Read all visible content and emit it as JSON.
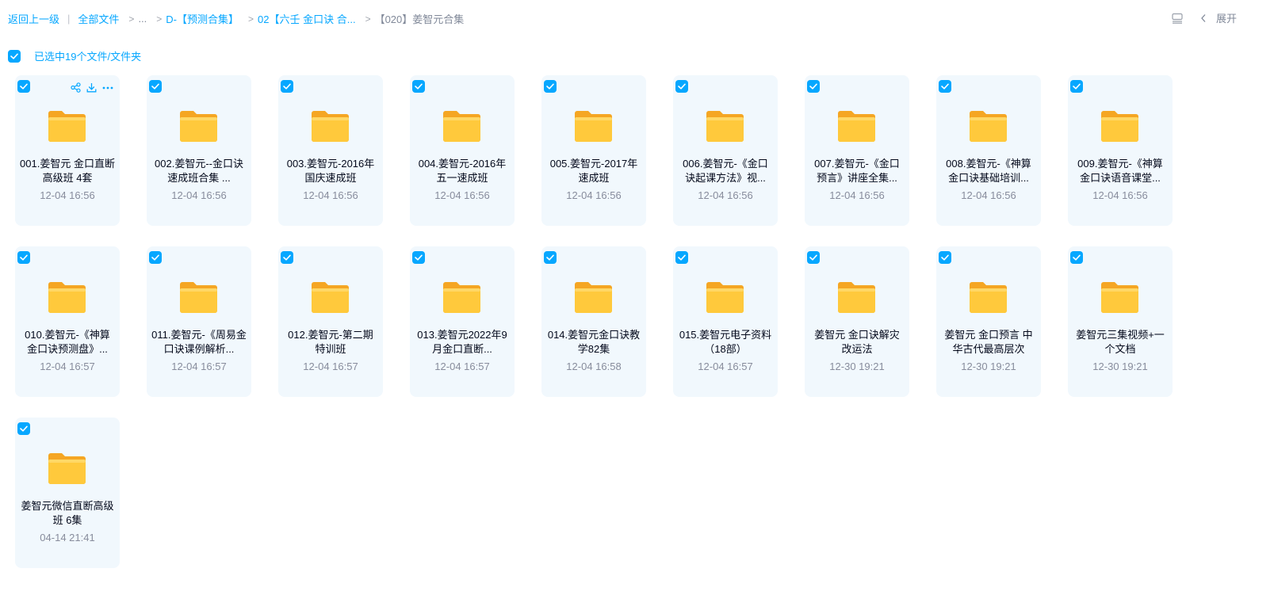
{
  "breadcrumb": {
    "back": "返回上一级",
    "all_files": "全部文件",
    "ellipsis": "...",
    "separator": ">",
    "level1": "D-【预测合集】",
    "level2": "02【六壬 金口诀 合...",
    "current": "【020】姜智元合集"
  },
  "toolbar": {
    "expand": "展开",
    "list_icon": "list-view-icon",
    "chevron_icon": "chevron-left-icon"
  },
  "selection": {
    "text": "已选中19个文件/文件夹"
  },
  "colors": {
    "accent": "#06a7ff",
    "card_bg": "#f1f8fd",
    "folder": "#ffc93c",
    "time": "#878c9c"
  },
  "items": [
    {
      "name": "001.姜智元 金口直断高级班 4套",
      "time": "12-04 16:56"
    },
    {
      "name": "002.姜智元--金口诀速成班合集 ...",
      "time": "12-04 16:56"
    },
    {
      "name": "003.姜智元-2016年国庆速成班",
      "time": "12-04 16:56"
    },
    {
      "name": "004.姜智元-2016年五一速成班",
      "time": "12-04 16:56"
    },
    {
      "name": "005.姜智元-2017年速成班",
      "time": "12-04 16:56"
    },
    {
      "name": "006.姜智元-《金口诀起课方法》视...",
      "time": "12-04 16:56"
    },
    {
      "name": "007.姜智元-《金口预言》讲座全集...",
      "time": "12-04 16:56"
    },
    {
      "name": "008.姜智元-《神算金口诀基础培训...",
      "time": "12-04 16:56"
    },
    {
      "name": "009.姜智元-《神算金口诀语音课堂...",
      "time": "12-04 16:56"
    },
    {
      "name": "010.姜智元-《神算金口诀预测盘》...",
      "time": "12-04 16:57"
    },
    {
      "name": "011.姜智元-《周易金口诀课例解析...",
      "time": "12-04 16:57"
    },
    {
      "name": "012.姜智元-第二期特训班",
      "time": "12-04 16:57"
    },
    {
      "name": "013.姜智元2022年9月金口直断...",
      "time": "12-04 16:57"
    },
    {
      "name": "014.姜智元金口诀教学82集",
      "time": "12-04 16:58"
    },
    {
      "name": "015.姜智元电子资料（18部）",
      "time": "12-04 16:57"
    },
    {
      "name": "姜智元 金口诀解灾改运法",
      "time": "12-30 19:21"
    },
    {
      "name": "姜智元 金口预言 中华古代最高层次",
      "time": "12-30 19:21"
    },
    {
      "name": "姜智元三集视频+一个文档",
      "time": "12-30 19:21"
    },
    {
      "name": "姜智元微信直断高级班 6集",
      "time": "04-14 21:41"
    }
  ]
}
